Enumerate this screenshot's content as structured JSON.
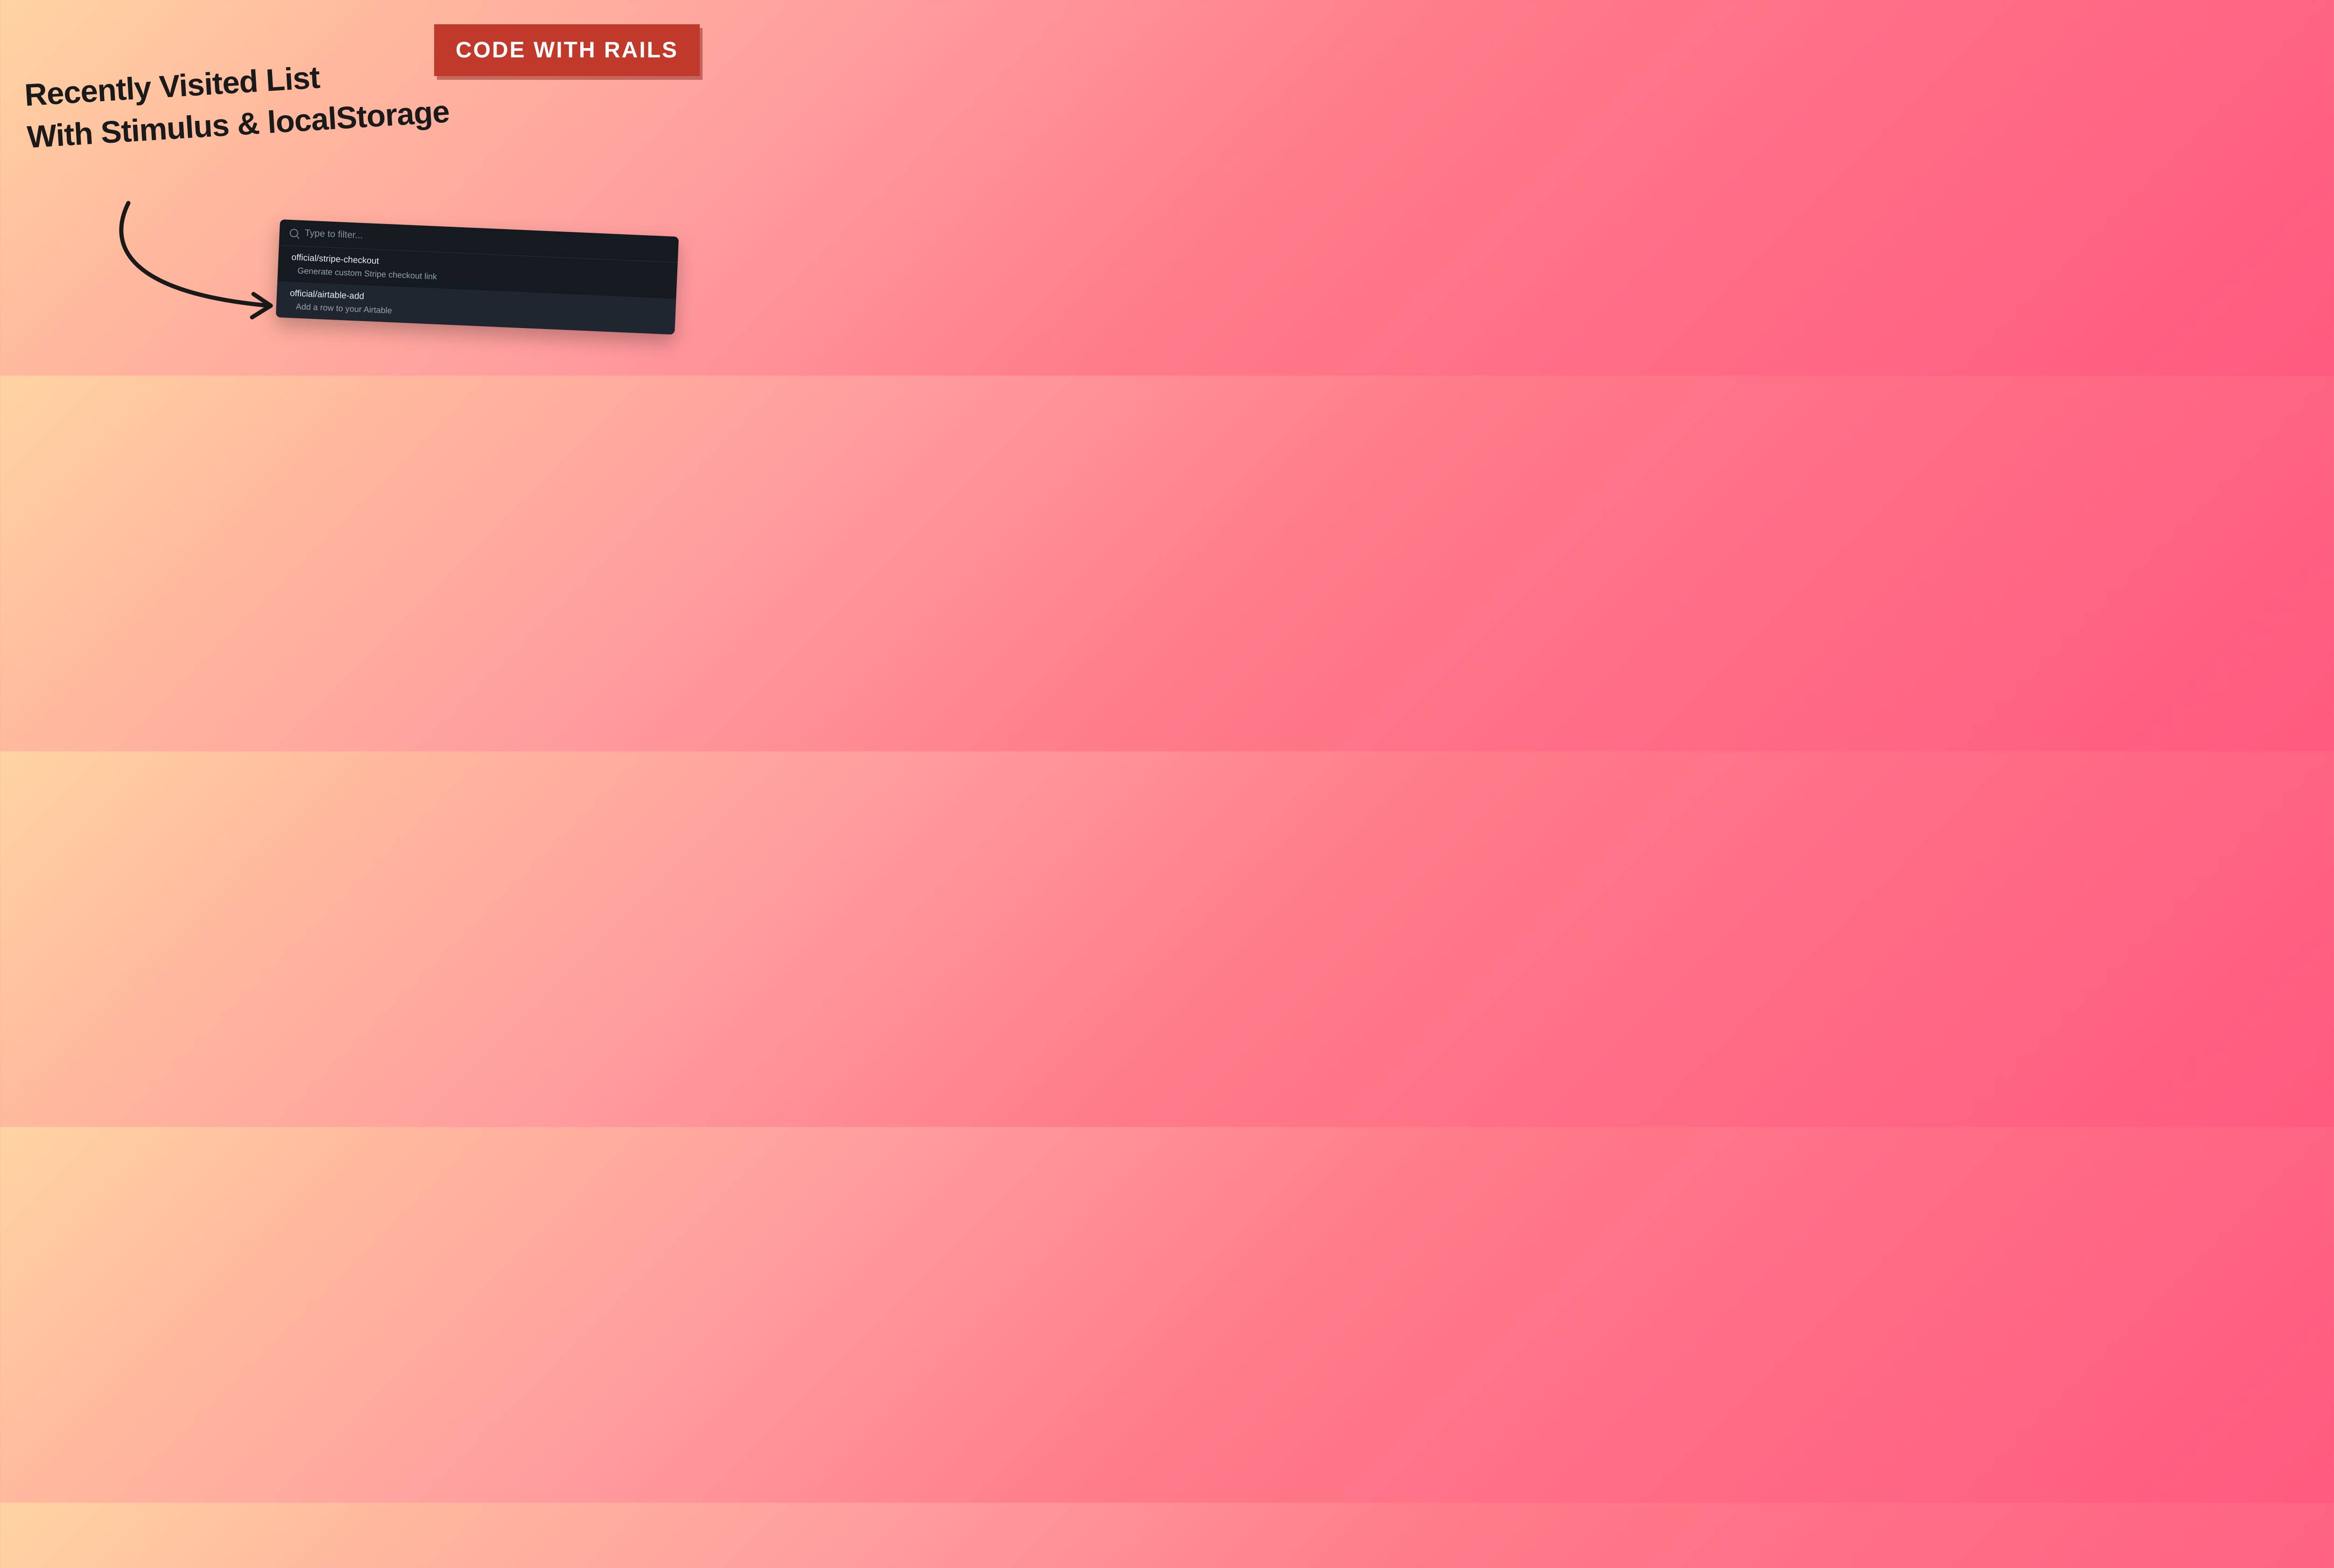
{
  "badge": {
    "label": "CODE WITH RAILS"
  },
  "headline": {
    "line1": "Recently Visited List",
    "line2": "With Stimulus & localStorage"
  },
  "palette": {
    "search_placeholder": "Type to filter...",
    "items": [
      {
        "title": "official/stripe-checkout",
        "desc": "Generate custom Stripe checkout link",
        "highlighted": false
      },
      {
        "title": "official/airtable-add",
        "desc": "Add a row to your Airtable",
        "highlighted": true
      }
    ]
  }
}
